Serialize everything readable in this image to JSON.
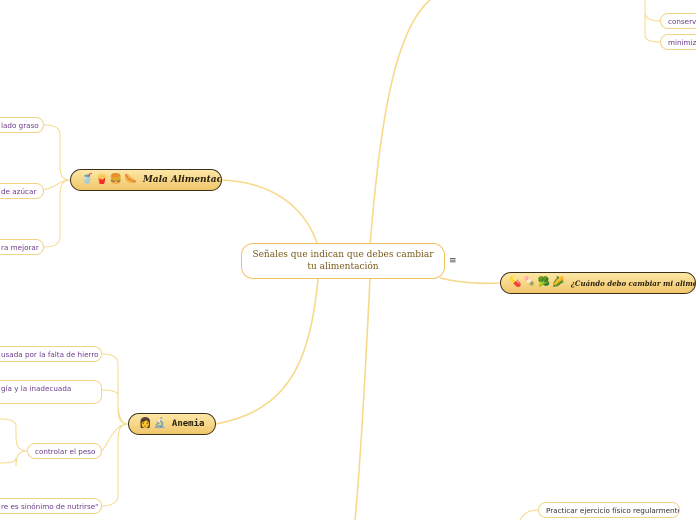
{
  "central": {
    "text": "Señales que indican que debes cambiar tu alimentación",
    "menu_icon": "≡"
  },
  "topics": {
    "mala": {
      "emojis": [
        "🥤",
        "🍟",
        "🍔",
        "🌭"
      ],
      "title": "Mala Alimentación"
    },
    "cuando": {
      "emojis": [
        "💊",
        "🍡",
        "🥦",
        "🌽"
      ],
      "title": "¿Cuándo debo cambiar mi alimentación?"
    },
    "anemia": {
      "emojis": [
        "👩",
        "🔬"
      ],
      "title": "Anemia"
    }
  },
  "leaves": {
    "m1": "lado graso",
    "m2": "de azúcar",
    "m3": "ra mejorar",
    "a1": "usada por la falta de hierro",
    "a2": "gía y la inadecuada",
    "a3": "controlar el peso",
    "a4": "re es sinónimo de nutrirse\"",
    "t1": "conserv",
    "t2": "minimiz",
    "b1": "Practicar ejercicio físico regularmente."
  },
  "colors": {
    "branch": "#f6d98a",
    "leaf_border": "#f3d488",
    "leaf_text": "#6b3b8a",
    "central_border": "#f2c35b"
  }
}
